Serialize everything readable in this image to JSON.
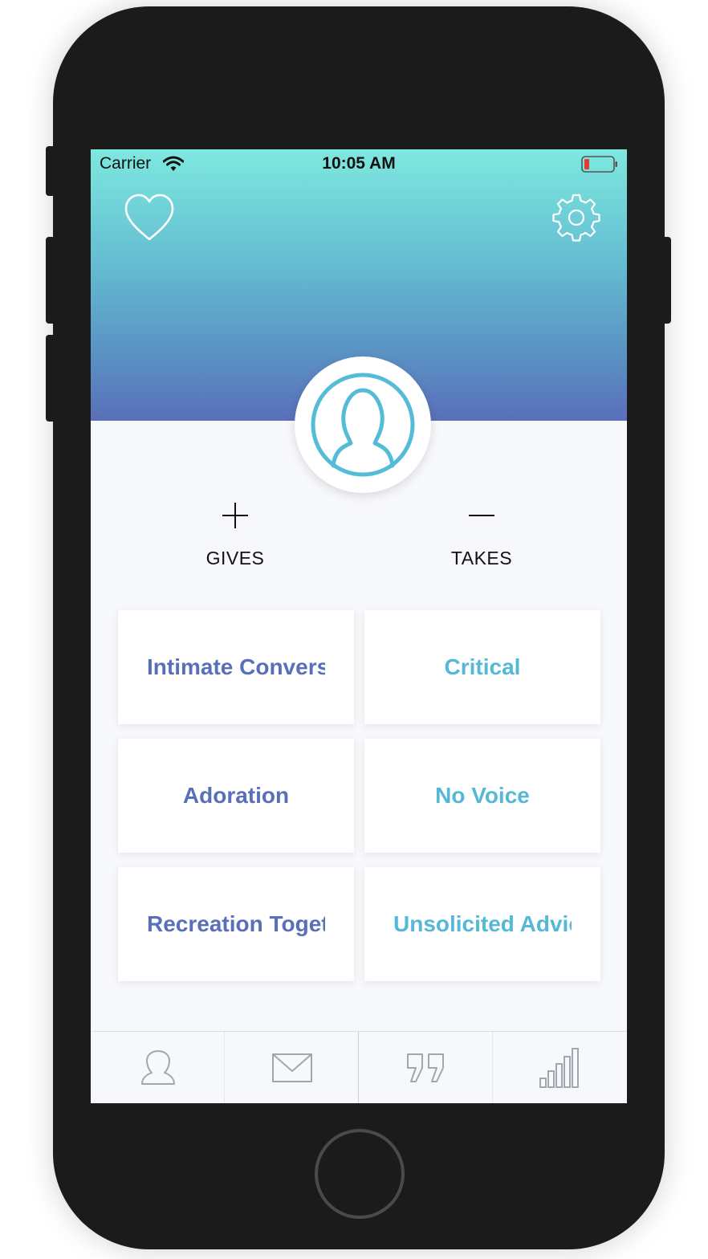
{
  "status_bar": {
    "carrier": "Carrier",
    "time": "10:05 AM"
  },
  "header": {
    "left_icon": "heart-icon",
    "right_icon": "gear-icon",
    "avatar_icon": "user-avatar-icon"
  },
  "counters": {
    "gives": {
      "symbol": "plus-icon",
      "label": "GIVES"
    },
    "takes": {
      "symbol": "minus-icon",
      "label": "TAKES"
    }
  },
  "cards": {
    "gives": [
      {
        "label": "Intimate Conversation"
      },
      {
        "label": "Adoration"
      },
      {
        "label": "Recreation Together"
      }
    ],
    "takes": [
      {
        "label": "Critical"
      },
      {
        "label": "No Voice"
      },
      {
        "label": "Unsolicited Advice"
      }
    ]
  },
  "tab_bar": {
    "tabs": [
      {
        "icon": "profile-icon"
      },
      {
        "icon": "mail-icon"
      },
      {
        "icon": "quote-icon"
      },
      {
        "icon": "stats-icon"
      }
    ]
  },
  "colors": {
    "gives_text": "#5a6fba",
    "takes_text": "#55b8d6",
    "header_top": "#7ee8df",
    "header_bottom": "#5a6fba"
  }
}
